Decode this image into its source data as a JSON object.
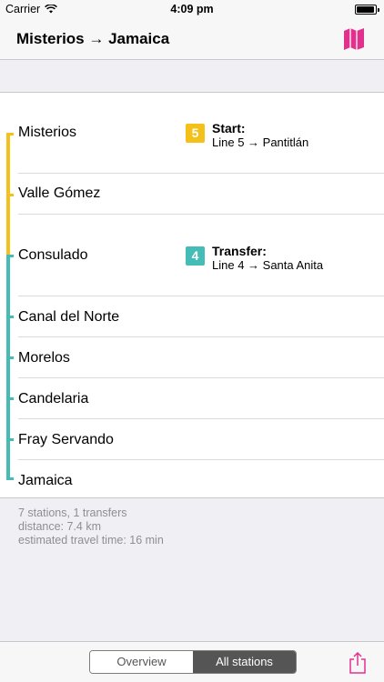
{
  "status_bar": {
    "carrier": "Carrier",
    "time": "4:09 pm",
    "battery_level": 0.95
  },
  "nav": {
    "title": "Misterios → Jamaica",
    "map_icon": "map-icon"
  },
  "colors": {
    "line5": "#f3c11a",
    "line4": "#45bcb6",
    "accent": "#e2318d"
  },
  "stations": [
    {
      "name": "Misterios"
    },
    {
      "name": "Valle Gómez"
    },
    {
      "name": "Consulado"
    },
    {
      "name": "Canal del Norte"
    },
    {
      "name": "Morelos"
    },
    {
      "name": "Candelaria"
    },
    {
      "name": "Fray Servando"
    },
    {
      "name": "Jamaica"
    }
  ],
  "start": {
    "badge": "5",
    "title": "Start:",
    "line": "Line 5 → Pantitlán"
  },
  "transfer": {
    "badge": "4",
    "title": "Transfer:",
    "line": "Line 4 → Santa Anita"
  },
  "summary": {
    "stations_transfers": "7 stations, 1 transfers",
    "distance": "distance: 7.4 km",
    "time": "estimated travel time: 16 min"
  },
  "toolbar": {
    "overview": "Overview",
    "all_stations": "All stations",
    "share_icon": "share-icon"
  }
}
